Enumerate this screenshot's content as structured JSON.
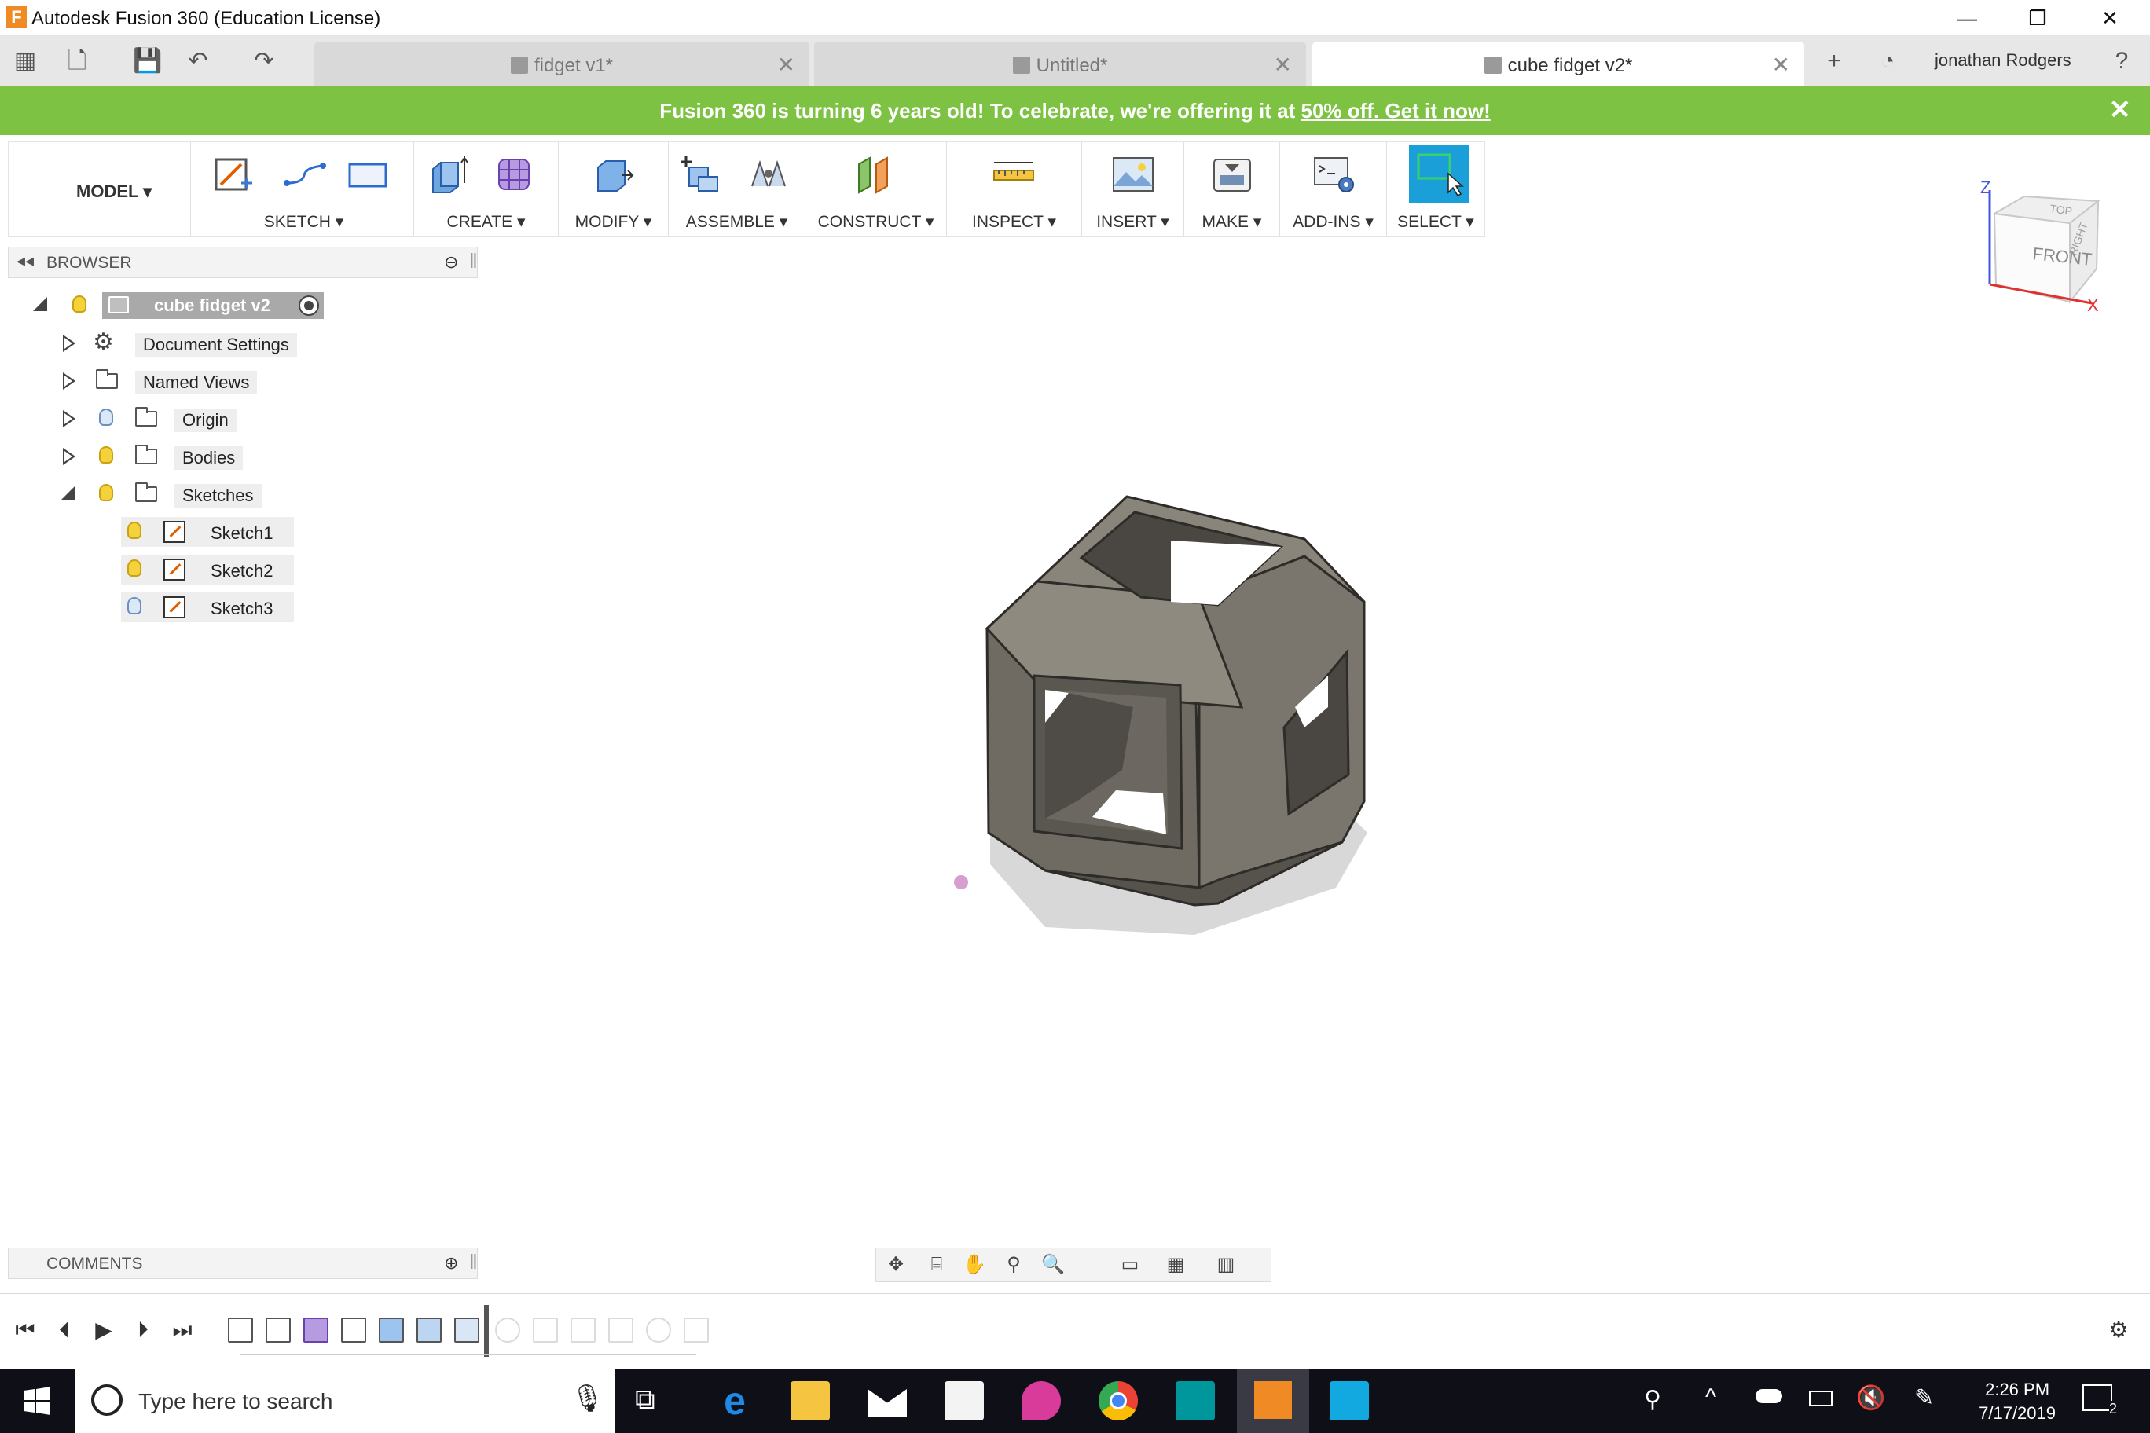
{
  "window": {
    "title": "Autodesk Fusion 360 (Education License)",
    "logo_letter": "F",
    "minimize": "—",
    "restore": "❐",
    "close": "✕"
  },
  "tabs": [
    {
      "label": "fidget v1*",
      "active": false
    },
    {
      "label": "Untitled*",
      "active": false
    },
    {
      "label": "cube fidget v2*",
      "active": true
    }
  ],
  "user": {
    "name": "jonathan Rodgers"
  },
  "banner": {
    "text": "Fusion 360 is turning 6 years old! To celebrate, we're offering it at ",
    "link": "50% off. Get it now!",
    "close": "✕"
  },
  "toolbar": {
    "workspace": "MODEL ▾",
    "groups": [
      "SKETCH ▾",
      "CREATE ▾",
      "MODIFY ▾",
      "ASSEMBLE ▾",
      "CONSTRUCT ▾",
      "INSPECT ▾",
      "INSERT ▾",
      "MAKE ▾",
      "ADD-INS ▾",
      "SELECT ▾"
    ]
  },
  "browser": {
    "header": "BROWSER",
    "root": "cube fidget v2",
    "items": [
      "Document Settings",
      "Named Views",
      "Origin",
      "Bodies",
      "Sketches"
    ],
    "sketches": [
      "Sketch1",
      "Sketch2",
      "Sketch3"
    ]
  },
  "viewcube": {
    "top": "TOP",
    "front": "FRONT",
    "right": "RIGHT",
    "axis_z": "Z",
    "axis_x": "X"
  },
  "comments": {
    "header": "COMMENTS"
  },
  "taskbar": {
    "search_placeholder": "Type here to search",
    "time": "2:26 PM",
    "date": "7/17/2019",
    "notifications": "2"
  },
  "colors": {
    "banner": "#7dc242",
    "select_active": "#1a9fd9",
    "model_body": "#6e6a63"
  }
}
